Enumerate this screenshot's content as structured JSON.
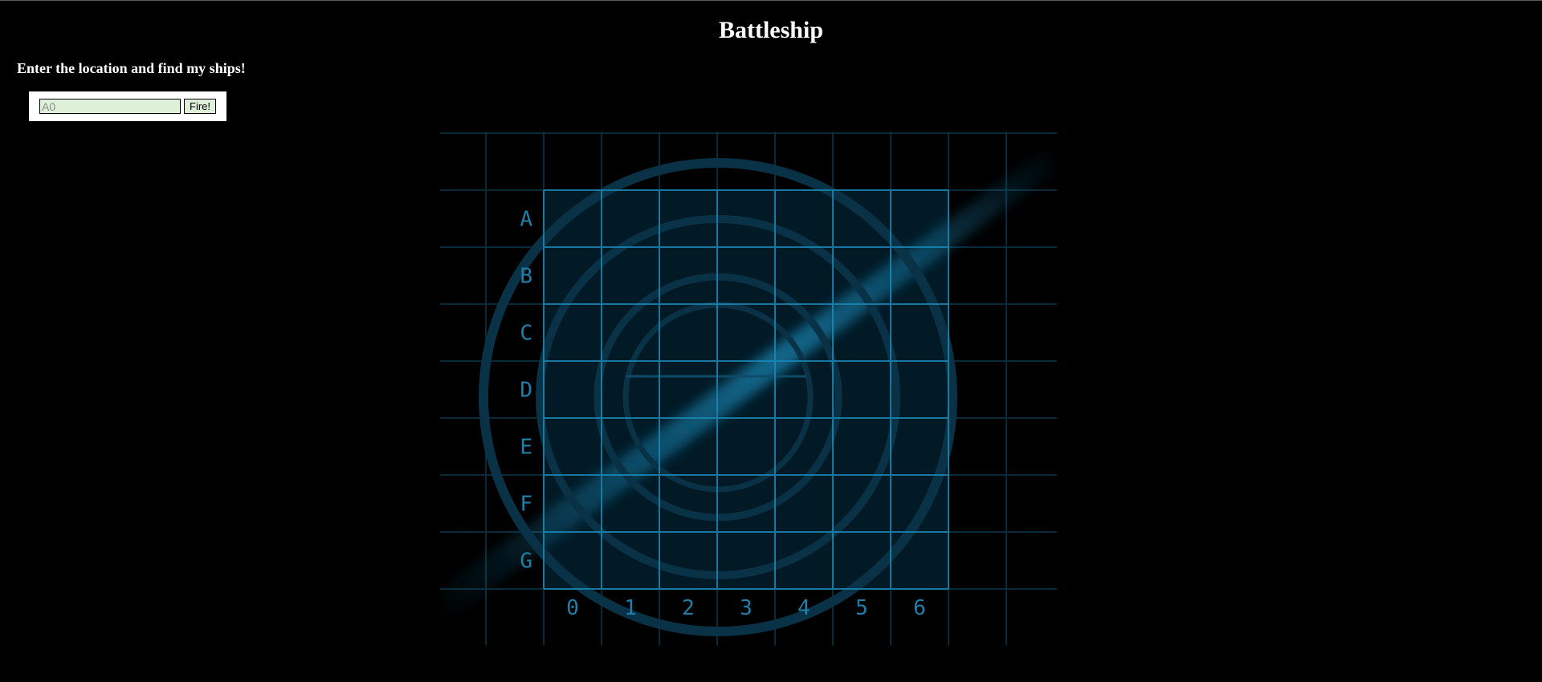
{
  "page": {
    "title": "Battleship",
    "instructions": "Enter the location and find my ships!"
  },
  "form": {
    "guess_placeholder": "A0",
    "guess_value": "",
    "fire_label": "Fire!"
  },
  "board": {
    "rows": [
      "A",
      "B",
      "C",
      "D",
      "E",
      "F",
      "G"
    ],
    "columns": [
      "0",
      "1",
      "2",
      "3",
      "4",
      "5",
      "6"
    ],
    "colors": {
      "background": "#000000",
      "grid": "#1b88b4",
      "ring": "#0a3246",
      "cell_fill": "#021a26",
      "label": "#1f7fa8",
      "form_field": "#dff0d8"
    },
    "icons": [
      "radar-icon"
    ]
  }
}
